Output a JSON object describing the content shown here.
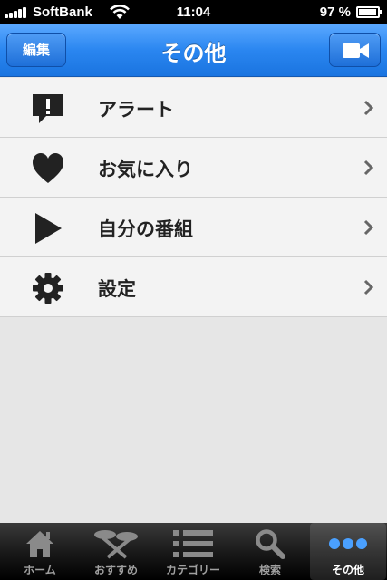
{
  "status_bar": {
    "carrier": "SoftBank",
    "time": "11:04",
    "battery_percent": "97 %",
    "battery_level": 0.97
  },
  "nav_bar": {
    "title": "その他",
    "edit_label": "編集",
    "camera_icon": "video-camera-icon"
  },
  "menu": {
    "items": [
      {
        "label": "アラート",
        "icon": "alert-speech-bubble-icon"
      },
      {
        "label": "お気に入り",
        "icon": "heart-icon"
      },
      {
        "label": "自分の番組",
        "icon": "play-icon"
      },
      {
        "label": "設定",
        "icon": "gear-icon"
      }
    ]
  },
  "tab_bar": {
    "tabs": [
      {
        "label": "ホーム",
        "icon": "home-icon",
        "active": false
      },
      {
        "label": "おすすめ",
        "icon": "recommend-icon",
        "active": false
      },
      {
        "label": "カテゴリー",
        "icon": "list-icon",
        "active": false
      },
      {
        "label": "検索",
        "icon": "search-icon",
        "active": false
      },
      {
        "label": "その他",
        "icon": "more-icon",
        "active": true
      }
    ]
  },
  "colors": {
    "nav_blue": "#2a86f0",
    "tab_bar_black": "#1a1a1a"
  }
}
